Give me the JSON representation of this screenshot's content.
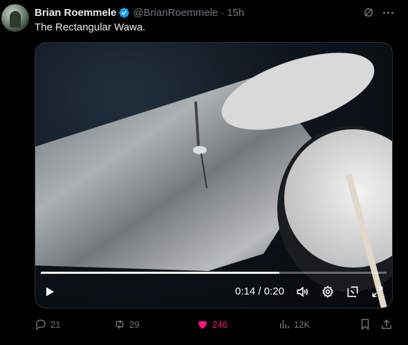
{
  "post": {
    "author_name": "Brian Roemmele",
    "handle": "@BrianRoemmele",
    "separator": "·",
    "time": "15h",
    "text": "The Rectangular Wawa.",
    "verified": true
  },
  "video": {
    "current_time": "0:14",
    "time_separator": "/",
    "duration": "0:20",
    "progress_fraction": 0.69
  },
  "actions": {
    "replies": "21",
    "reposts": "29",
    "likes": "246",
    "views": "12K",
    "liked": true
  },
  "colors": {
    "like": "#f91880",
    "verified": "#1d9bf0",
    "muted_text": "#71767b"
  },
  "icons": {
    "verified": "verified-badge-icon",
    "grok": "grok-icon",
    "more": "more-icon",
    "play": "play-icon",
    "volume": "volume-icon",
    "settings": "settings-icon",
    "pip": "pip-icon",
    "fullscreen": "fullscreen-icon",
    "reply": "reply-icon",
    "repost": "repost-icon",
    "like": "heart-icon",
    "views": "views-icon",
    "bookmark": "bookmark-icon",
    "share": "share-icon"
  }
}
